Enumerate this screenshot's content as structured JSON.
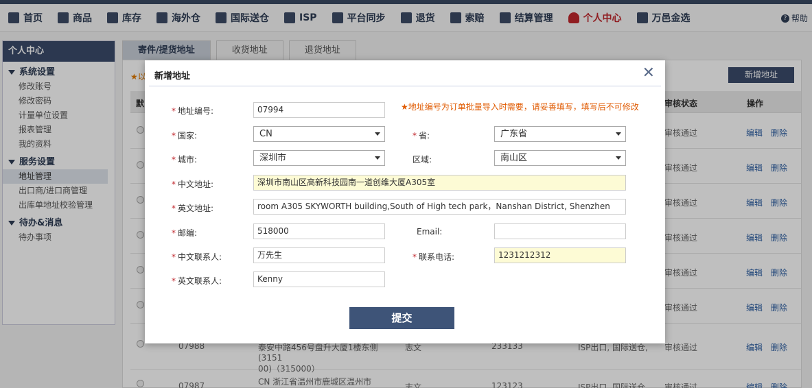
{
  "nav": {
    "items": [
      {
        "label": "首页",
        "icon": "home-icon"
      },
      {
        "label": "商品",
        "icon": "box-icon"
      },
      {
        "label": "库存",
        "icon": "warehouse-icon"
      },
      {
        "label": "海外仓",
        "icon": "overseas-warehouse-icon"
      },
      {
        "label": "国际送仓",
        "icon": "international-icon"
      },
      {
        "label": "ISP",
        "icon": "plane-icon"
      },
      {
        "label": "平台同步",
        "icon": "cloud-sync-icon"
      },
      {
        "label": "退货",
        "icon": "return-icon"
      },
      {
        "label": "索赔",
        "icon": "grid-icon"
      },
      {
        "label": "结算管理",
        "icon": "wallet-icon"
      },
      {
        "label": "个人中心",
        "icon": "user-icon"
      },
      {
        "label": "万邑金选",
        "icon": "diamond-icon"
      }
    ],
    "help": "帮助"
  },
  "sidebar": {
    "title": "个人中心",
    "groups": [
      {
        "title": "系统设置",
        "items": [
          "修改账号",
          "修改密码",
          "计量单位设置",
          "报表管理",
          "我的资料"
        ]
      },
      {
        "title": "服务设置",
        "items": [
          "地址管理",
          "出口商/进口商管理",
          "出库单地址校验管理"
        ]
      },
      {
        "title": "待办&消息",
        "items": [
          "待办事项"
        ]
      }
    ]
  },
  "tabs": [
    "寄件/提货地址",
    "收货地址",
    "退货地址"
  ],
  "page": {
    "new_button": "新增地址",
    "hint_prefix": "以",
    "headers": {
      "default": "默",
      "status": "审核状态",
      "action": "操作"
    },
    "rows": [
      {
        "status": "审核通过",
        "edit": "编辑",
        "delete": "删除"
      },
      {
        "status": "审核通过",
        "edit": "编辑",
        "delete": "删除"
      },
      {
        "status": "审核通过",
        "edit": "编辑",
        "delete": "删除"
      },
      {
        "status": "审核通过",
        "edit": "编辑",
        "delete": "删除"
      },
      {
        "status": "审核通过",
        "edit": "编辑",
        "delete": "删除"
      },
      {
        "status": "审核通过",
        "edit": "编辑",
        "delete": "删除"
      },
      {
        "code": "07988",
        "addr1": "泰安中路456号盘升大厦1楼东侧(3151",
        "addr2": "00)（315000）",
        "name": "志文",
        "zip": "233133",
        "type": "ISP出口, 国际送仓,",
        "status": "审核通过",
        "edit": "编辑",
        "delete": "删除"
      },
      {
        "code": "07987",
        "addr1": "CN 浙江省温州市鹿城区温州市jicsadv",
        "name": "志文",
        "zip": "123123",
        "type": "ISP出口, 国际送仓",
        "status": "审核通过",
        "edit": "编辑",
        "delete": "删除"
      }
    ]
  },
  "modal": {
    "title": "新增地址",
    "warning": "地址编号为订单批量导入时需要，请妥善填写，填写后不可修改",
    "fields": {
      "code": {
        "label": "地址编号:",
        "value": "07994"
      },
      "country": {
        "label": "国家:",
        "value": "CN"
      },
      "province": {
        "label": "省:",
        "value": "广东省"
      },
      "city": {
        "label": "城市:",
        "value": "深圳市"
      },
      "district": {
        "label": "区域:",
        "value": "南山区"
      },
      "cn_address": {
        "label": "中文地址:",
        "value": "深圳市南山区高新科技园南一道创维大厦A305室"
      },
      "en_address": {
        "label": "英文地址:",
        "value": "room A305 SKYWORTH building,South of High tech park，Nanshan District, Shenzhen"
      },
      "zip": {
        "label": "邮编:",
        "value": "518000"
      },
      "email": {
        "label": "Email:",
        "value": ""
      },
      "cn_contact": {
        "label": "中文联系人:",
        "value": "万先生"
      },
      "phone": {
        "label": "联系电话:",
        "value": "1231212312"
      },
      "en_contact": {
        "label": "英文联系人:",
        "value": "Kenny"
      }
    },
    "submit": "提交"
  },
  "colors": {
    "brand": "#3b4b6b",
    "active": "#c0272d",
    "warning": "#e05a00",
    "highlight": "#fdfbd5"
  }
}
